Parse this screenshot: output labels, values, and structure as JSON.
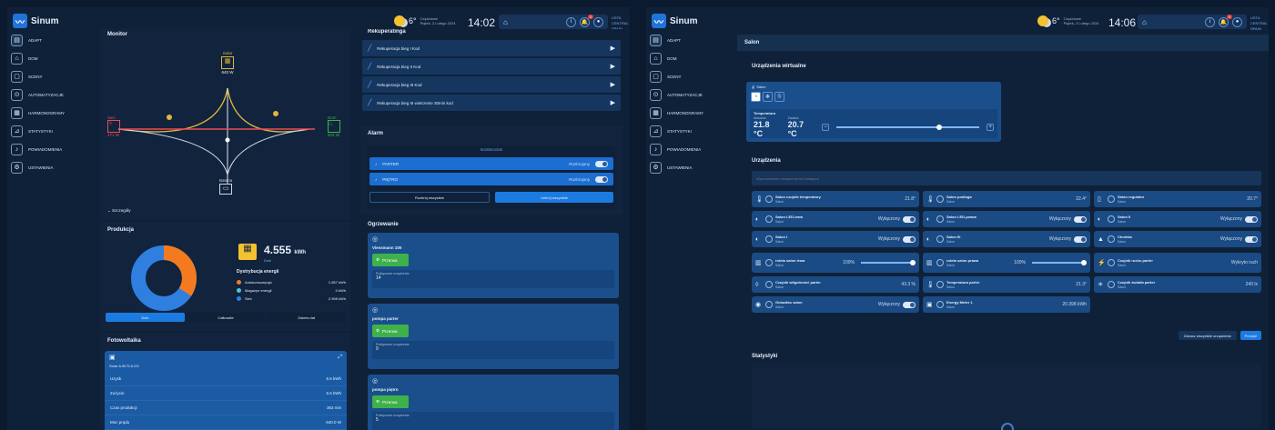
{
  "brand": {
    "name": "Sinum"
  },
  "sidebar": {
    "items": [
      {
        "label": "ADAPT",
        "icon": "grid-icon"
      },
      {
        "label": "DOM",
        "icon": "home-icon"
      },
      {
        "label": "SCENY",
        "icon": "scenes-icon"
      },
      {
        "label": "AUTOMATYZACJE",
        "icon": "automation-icon"
      },
      {
        "label": "HARMONOGRAMY",
        "icon": "calendar-icon"
      },
      {
        "label": "STATYSTYKI",
        "icon": "chart-icon"
      },
      {
        "label": "POWIADOMIENIA",
        "icon": "bell-icon"
      },
      {
        "label": "USTAWIENIA",
        "icon": "gear-icon"
      }
    ]
  },
  "screen1": {
    "topbar": {
      "temperature": "6°",
      "weather_line1": "Częściowe",
      "weather_line2": "Piątek, 2 Lutego 2024",
      "time": "14:02",
      "badge": "0",
      "user_line1": "USTA",
      "user_line2": "CENTRAL SPAIN"
    },
    "monitor": {
      "title": "Monitor",
      "solar": {
        "label": "Solar",
        "value": "640 W"
      },
      "grid": {
        "label": "Sieć",
        "value": "471 W"
      },
      "home": {
        "label": "Dom",
        "value": "503 W"
      },
      "battery": {
        "label": "Bateria"
      },
      "details": "Szczegóły"
    },
    "production": {
      "title": "Produkcja",
      "value": "4.555",
      "unit": "kWh",
      "period": "Dziś",
      "dist_title": "Dystrybucja energii",
      "legend": [
        {
          "label": "Autokonsumpcja",
          "value": "1.557 kWh",
          "color": "#f47a20"
        },
        {
          "label": "Magazyn energii",
          "value": "0 kWh",
          "color": "#4fc3d9"
        },
        {
          "label": "Sieć",
          "value": "2.998 kWh",
          "color": "#2f7fe0"
        }
      ],
      "tabs": [
        "Dziś",
        "Całkowite",
        "Zakres dat"
      ]
    },
    "pv": {
      "title": "Fotowoltaika",
      "device": "Solar 8-9KTL6-G3",
      "rows": [
        {
          "label": "Uzysk",
          "value": "5.5 kWh"
        },
        {
          "label": "Zużycie",
          "value": "5.5 kWh"
        },
        {
          "label": "Czas produkcji",
          "value": "363 min"
        },
        {
          "label": "Moc prądu",
          "value": "640.0 W"
        }
      ]
    },
    "recuperation": {
      "title": "Rekuperatinga",
      "items": [
        "Rekuperacja bieg I Kod",
        "Rekuperacja bieg II Kod",
        "Rekuperacja bieg III Kod",
        "Rekuperacja bieg III wietrzenie 30min kod"
      ]
    },
    "alarm": {
      "title": "Alarm",
      "section": "ROZBROJONE",
      "zones": [
        {
          "label": "PARTER",
          "state": "Rozbrojony"
        },
        {
          "label": "PIĘTRO",
          "state": "Rozbrojony"
        }
      ],
      "btn_disarm": "Rozbrój wszystkie",
      "btn_arm": "Uzbrój wszystkie"
    },
    "heating": {
      "title": "Ogrzewanie",
      "cards": [
        {
          "name": "Viessmann 100",
          "state": "Przerwa",
          "sub": "Podłączone urządzenia",
          "count": "14"
        },
        {
          "name": "pompa parter",
          "state": "Przerwa",
          "sub": "Podłączone urządzenia",
          "count": "9"
        },
        {
          "name": "pompa piętro",
          "state": "Przerwa",
          "sub": "Podłączone urządzenia",
          "count": "5"
        }
      ]
    }
  },
  "screen2": {
    "topbar": {
      "temperature": "6°",
      "weather_line1": "Częściowe",
      "weather_line2": "Piątek, 2 Lutego 2024",
      "time": "14:06",
      "badge": "0",
      "user_line1": "USTA",
      "user_line2": "CENTRAL SPAIN"
    },
    "room_title": "Salon",
    "virtual": {
      "title": "Urządzenia wirtualne",
      "card": {
        "name": "Salon",
        "temp_title": "Temperatura",
        "current_label": "Aktualna",
        "current": "21.8 °C",
        "target_label": "Zadana",
        "target": "20.7 °C"
      }
    },
    "devices": {
      "title": "Urządzenia",
      "search_placeholder": "Wyszukiwanie urządzenia lub kategorii",
      "items": [
        {
          "name": "Salon czujnik temperatury",
          "room": "Salon",
          "value": "21.8°",
          "icon": "thermometer-icon"
        },
        {
          "name": "Salon podłoga",
          "room": "Salon",
          "value": "22.4°",
          "icon": "thermometer-icon"
        },
        {
          "name": "Salon regulator",
          "room": "Salon",
          "value": "20.7°",
          "icon": "thermostat-icon"
        },
        {
          "name": "Salon LED-lewa",
          "room": "Salon",
          "value": "Wyłączony",
          "icon": "light-icon"
        },
        {
          "name": "Salon LED-prawa",
          "room": "Salon",
          "value": "Wyłączony",
          "icon": "light-icon"
        },
        {
          "name": "Salon II",
          "room": "Salon",
          "value": "Wyłączony",
          "icon": "light-icon"
        },
        {
          "name": "Salon I",
          "room": "Salon",
          "value": "Wyłączony",
          "icon": "light-icon"
        },
        {
          "name": "Salon III",
          "room": "Salon",
          "value": "Wyłączony",
          "icon": "light-icon"
        },
        {
          "name": "Choinka",
          "room": "Salon",
          "value": "Wyłączony",
          "icon": "tree-icon"
        },
        {
          "name": "roleta salon lewa",
          "room": "Salon",
          "value": "100%",
          "icon": "blind-icon"
        },
        {
          "name": "roleta salon prawa",
          "room": "Salon",
          "value": "100%",
          "icon": "blind-icon"
        },
        {
          "name": "Czujnik ruchu parter",
          "room": "Salon",
          "value": "Wykryto ruch",
          "icon": "motion-icon"
        },
        {
          "name": "Czujnik wilgotności parter",
          "room": "Salon",
          "value": "43.3 %",
          "icon": "humidity-icon"
        },
        {
          "name": "Temperatura parter",
          "room": "Salon",
          "value": "21.3°",
          "icon": "thermometer-icon"
        },
        {
          "name": "Czujnik światła parter",
          "room": "Salon",
          "value": "240 lx",
          "icon": "lux-icon"
        },
        {
          "name": "Gniazdko salon",
          "room": "Salon",
          "value": "Wyłączony",
          "icon": "socket-icon"
        },
        {
          "name": "Energy Meter 1",
          "room": "Salon",
          "value": "20.398 kWh",
          "icon": "meter-icon"
        }
      ],
      "see_all": "Zobacz wszystkie urządzenia",
      "go_btn": "Przejdź"
    },
    "stats": {
      "title": "Statystyki"
    }
  }
}
